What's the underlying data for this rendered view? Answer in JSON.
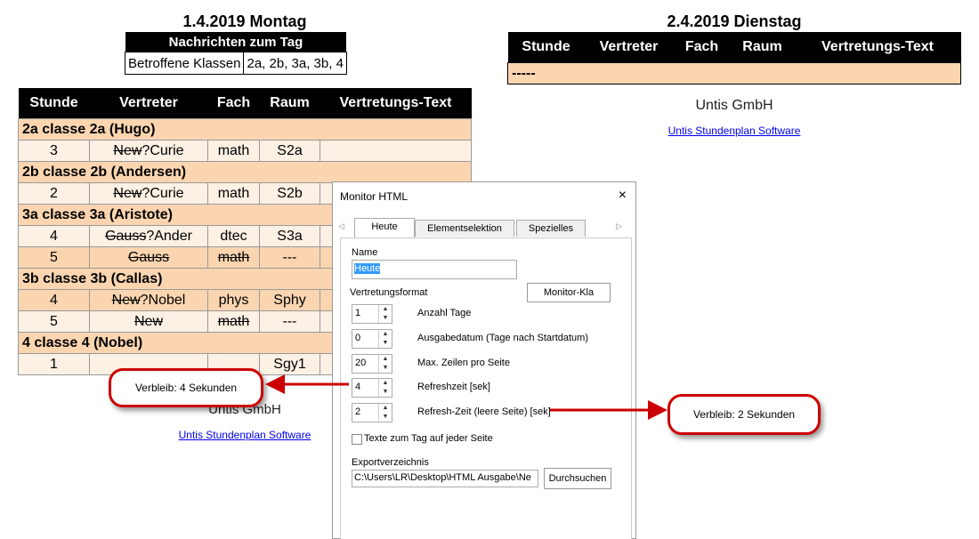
{
  "day1": {
    "title": "1.4.2019 Montag",
    "news": {
      "header": "Nachrichten zum Tag",
      "label": "Betroffene Klassen",
      "value": "2a, 2b, 3a, 3b, 4"
    },
    "columns": [
      "Stunde",
      "Vertreter",
      "Fach",
      "Raum",
      "Vertretungs-Text"
    ],
    "groups": [
      {
        "cls": "2a classe 2a (Hugo)",
        "rows": [
          {
            "stunde": "3",
            "vert_strike": "New",
            "vert": "?Curie",
            "fach": "math",
            "raum": "S2a",
            "text": ""
          }
        ]
      },
      {
        "cls": "2b classe 2b (Andersen)",
        "rows": [
          {
            "stunde": "2",
            "vert_strike": "New",
            "vert": "?Curie",
            "fach": "math",
            "raum": "S2b",
            "text": ""
          }
        ]
      },
      {
        "cls": "3a classe 3a (Aristote)",
        "rows": [
          {
            "stunde": "4",
            "vert_strike": "Gauss",
            "vert": "?Ander",
            "fach": "dtec",
            "raum": "S3a",
            "text": ""
          },
          {
            "stunde": "5",
            "vert_strike": "Gauss",
            "vert": "",
            "fach_strike": "math",
            "raum": "---",
            "text": ""
          }
        ]
      },
      {
        "cls": "3b classe 3b (Callas)",
        "rows": [
          {
            "stunde": "4",
            "vert_strike": "New",
            "vert": "?Nobel",
            "fach": "phys",
            "raum": "Sphy",
            "text": ""
          },
          {
            "stunde": "5",
            "vert_strike": "New",
            "vert": "",
            "fach_strike": "math",
            "raum": "---",
            "text": ""
          }
        ]
      },
      {
        "cls": "4 classe 4 (Nobel)",
        "rows": [
          {
            "stunde": "1",
            "vert_strike": "",
            "vert": "",
            "fach": "",
            "raum": "Sgy1",
            "text": ""
          }
        ]
      }
    ],
    "footer": "Untis GmbH",
    "link": "Untis Stundenplan Software"
  },
  "day2": {
    "title": "2.4.2019 Dienstag",
    "columns": [
      "Stunde",
      "Vertreter",
      "Fach",
      "Raum",
      "Vertretungs-Text"
    ],
    "empty_row": "-----",
    "footer": "Untis GmbH",
    "link": "Untis Stundenplan Software"
  },
  "dialog": {
    "title": "Monitor HTML",
    "close_icon": "×",
    "tabs": [
      "Heute",
      "Elementselektion",
      "Spezielles"
    ],
    "name_label": "Name",
    "name_value": "Heute",
    "format_label": "Vertretungsformat",
    "format_button": "Monitor-Kla",
    "fields": [
      {
        "value": "1",
        "label": "Anzahl Tage"
      },
      {
        "value": "0",
        "label": "Ausgabedatum (Tage nach Startdatum)"
      },
      {
        "value": "20",
        "label": "Max. Zeilen pro Seite"
      },
      {
        "value": "4",
        "label": "Refreshzeit [sek]"
      },
      {
        "value": "2",
        "label": "Refresh-Zeit (leere Seite) [sek]"
      }
    ],
    "checkbox_label": "Texte zum Tag auf jeder Seite",
    "export_label": "Exportverzeichnis",
    "export_value": "C:\\Users\\LR\\Desktop\\HTML Ausgabe\\Ne",
    "browse_button": "Durchsuchen"
  },
  "callouts": {
    "left": "Verbleib: 4 Sekunden",
    "right": "Verbleib: 2 Sekunden"
  },
  "colors": {
    "header": "#000000",
    "class_row": "#fad5b0",
    "light_row": "#fdf0e4",
    "arrow": "#c00000"
  }
}
